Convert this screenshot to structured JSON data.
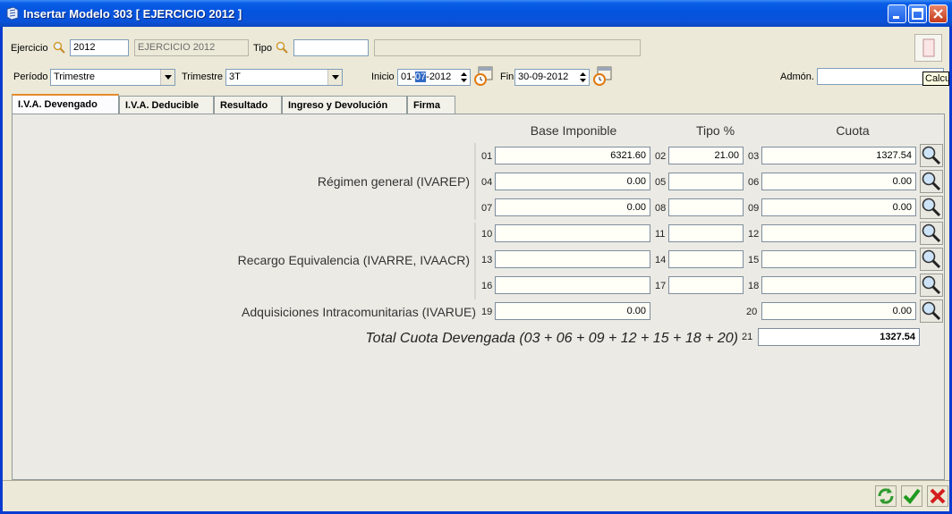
{
  "window": {
    "title": "Insertar Modelo 303 [ EJERCICIO 2012 ]"
  },
  "header": {
    "ejercicio_label": "Ejercicio",
    "ejercicio_value": "2012",
    "ejercicio_desc": "EJERCICIO 2012",
    "tipo_label": "Tipo",
    "tipo_value": "",
    "tipo_desc": "",
    "periodo_label": "Período",
    "periodo_value": "Trimestre",
    "trimestre_label": "Trimestre",
    "trimestre_value": "3T",
    "inicio_label": "Inicio",
    "inicio_prefix": "01-",
    "inicio_selected": "07",
    "inicio_suffix": "-2012",
    "fin_label": "Fin",
    "fin_value": "30-09-2012",
    "admon_label": "Admón.",
    "admon_value": "",
    "tooltip": "Calcula"
  },
  "tabs": [
    {
      "label": "I.V.A. Devengado"
    },
    {
      "label": "I.V.A. Deducible"
    },
    {
      "label": "Resultado"
    },
    {
      "label": "Ingreso y Devolución"
    },
    {
      "label": "Firma"
    }
  ],
  "columns": {
    "base": "Base Imponible",
    "tipo": "Tipo %",
    "cuota": "Cuota"
  },
  "sections": {
    "general": "Régimen general (IVAREP)",
    "recargo": "Recargo Equivalencia (IVARRE, IVAACR)",
    "adquisiciones": "Adquisiciones Intracomunitarias (IVARUE)",
    "total": "Total Cuota Devengada (03 + 06 + 09 + 12 + 15 + 18 + 20)"
  },
  "rows": [
    {
      "n1": "01",
      "base": "6321.60",
      "n2": "02",
      "tipo": "21.00",
      "n3": "03",
      "cuota": "1327.54"
    },
    {
      "n1": "04",
      "base": "0.00",
      "n2": "05",
      "tipo": "",
      "n3": "06",
      "cuota": "0.00"
    },
    {
      "n1": "07",
      "base": "0.00",
      "n2": "08",
      "tipo": "",
      "n3": "09",
      "cuota": "0.00"
    },
    {
      "n1": "10",
      "base": "",
      "n2": "11",
      "tipo": "",
      "n3": "12",
      "cuota": ""
    },
    {
      "n1": "13",
      "base": "",
      "n2": "14",
      "tipo": "",
      "n3": "15",
      "cuota": ""
    },
    {
      "n1": "16",
      "base": "",
      "n2": "17",
      "tipo": "",
      "n3": "18",
      "cuota": ""
    }
  ],
  "adq": {
    "n1": "19",
    "base": "0.00",
    "n3": "20",
    "cuota": "0.00"
  },
  "total": {
    "n": "21",
    "value": "1327.54"
  },
  "icons": {
    "search": "magnifier-icon",
    "calendar": "calendar-icon",
    "refresh": "refresh-icon",
    "accept": "check-icon",
    "cancel": "close-icon"
  }
}
